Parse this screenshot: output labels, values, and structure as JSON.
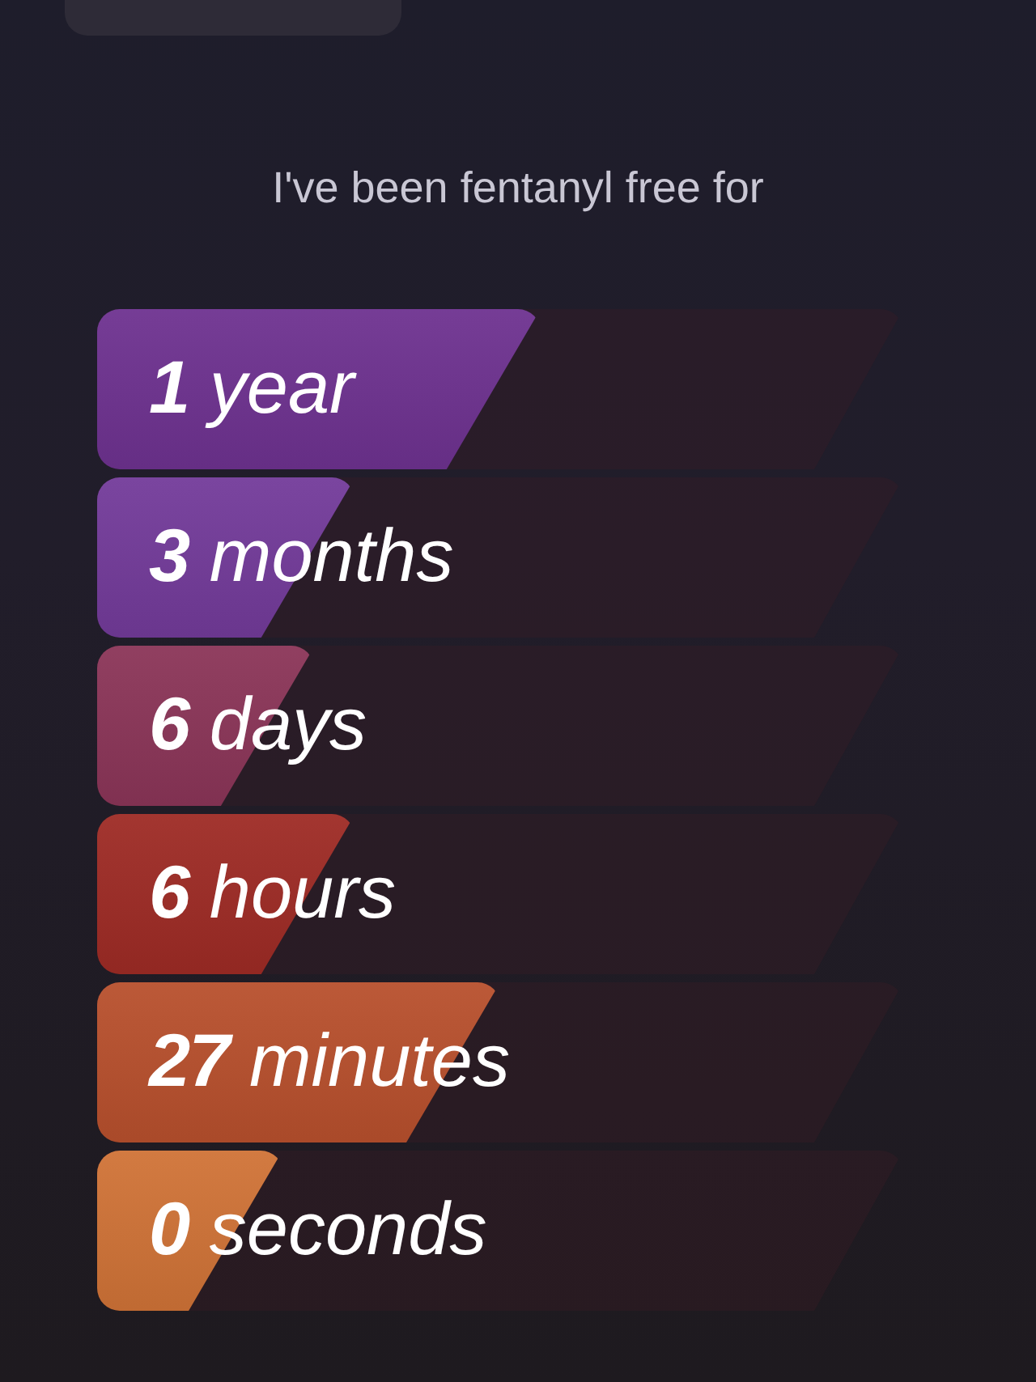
{
  "heading": "I've been fentanyl free for",
  "items": [
    {
      "text": "**1** year",
      "level": 0.55,
      "color": "#6e3290"
    },
    {
      "text": "**3** months",
      "level": 0.32,
      "color": "#733b9a"
    },
    {
      "text": "**6** days",
      "level": 0.27,
      "color": "#8b3558"
    },
    {
      "text": "**6** hours",
      "level": 0.32,
      "color": "#9e2b25"
    },
    {
      "text": "**27** minutes",
      "level": 0.5,
      "color": "#b8502d"
    },
    {
      "text": "**0** seconds",
      "level": 0.23,
      "color": "#d07337"
    }
  ]
}
